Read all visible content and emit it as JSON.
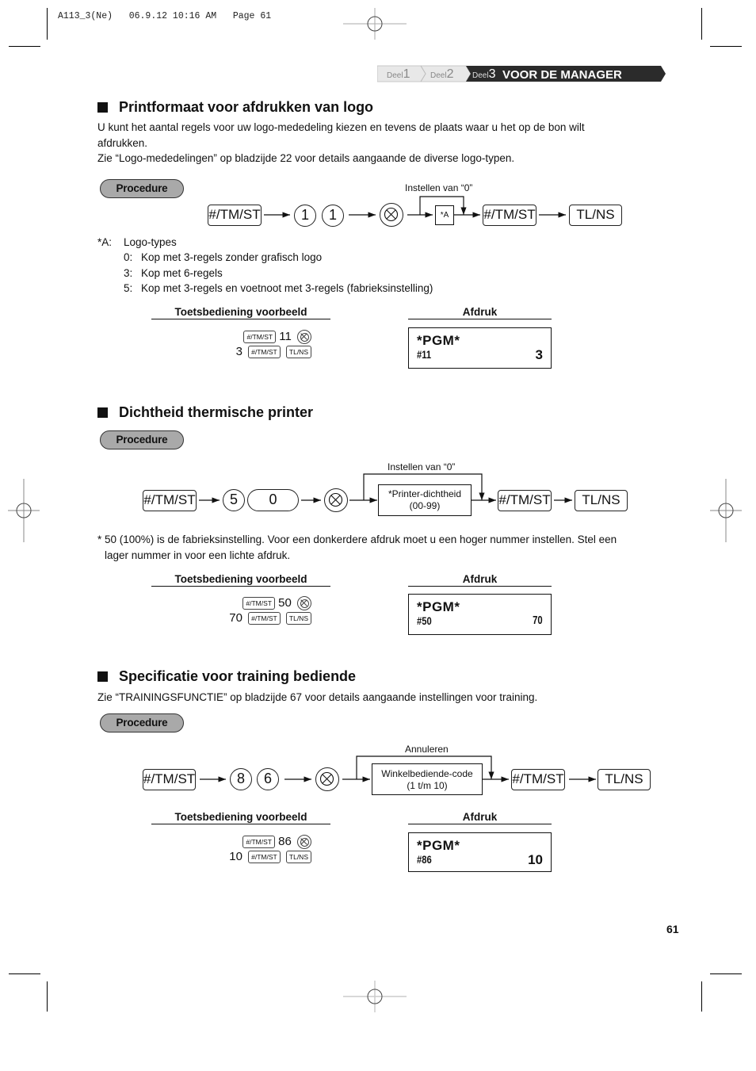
{
  "header_meta": "A113_3(Ne)   06.9.12 10:16 AM   Page 61",
  "breadcrumb": {
    "items": [
      {
        "prefix": "Deel",
        "num": "1"
      },
      {
        "prefix": "Deel",
        "num": "2"
      },
      {
        "prefix": "Deel",
        "num": "3"
      }
    ],
    "current_title": "VOOR DE MANAGER",
    "colors": {
      "active_bg": "#2a2a2a",
      "inactive_bg": "#e6e6e6"
    }
  },
  "sections": [
    {
      "title": "Printformaat voor afdrukken van logo",
      "paragraphs": [
        "U kunt het aantal regels voor uw logo-mededeling kiezen en tevens de plaats waar u het op de bon wilt",
        "afdrukken.",
        "Zie “Logo-mededelingen” op bladzijde 22 voor details aangaande de diverse logo-typen."
      ],
      "procedure_label": "Procedure",
      "flow": {
        "key1": "#/TM/ST",
        "digits": [
          "1",
          "1"
        ],
        "bypass_label": "Instellen van “0”",
        "input_box": "*A",
        "key2": "#/TM/ST",
        "key3": "TL/NS"
      },
      "notes": {
        "label": "*A:",
        "title": "Logo-types",
        "items": [
          {
            "key": "0:",
            "text": "Kop met 3-regels zonder grafisch logo"
          },
          {
            "key": "3:",
            "text": "Kop met 6-regels"
          },
          {
            "key": "5:",
            "text": "Kop met 3-regels en voetnoot met 3-regels (fabrieksinstelling)"
          }
        ]
      },
      "example": {
        "keys_heading": "Toetsbediening voorbeeld",
        "print_heading": "Afdruk",
        "line1": {
          "key": "#/TM/ST",
          "value": "11"
        },
        "line2": {
          "value": "3",
          "key1": "#/TM/ST",
          "key2": "TL/NS"
        },
        "receipt": {
          "title": "*PGM*",
          "code": "#11",
          "value": "3"
        }
      }
    },
    {
      "title": "Dichtheid thermische printer",
      "procedure_label": "Procedure",
      "flow": {
        "key1": "#/TM/ST",
        "digits": [
          "5",
          "0"
        ],
        "bypass_label": "Instellen van “0”",
        "input_box_line1": "*Printer-dichtheid",
        "input_box_line2": "(00-99)",
        "key2": "#/TM/ST",
        "key3": "TL/NS"
      },
      "footnote_line1": "* 50 (100%) is de fabrieksinstelling. Voor een donkerdere afdruk moet u een hoger nummer instellen. Stel een",
      "footnote_line2": "lager nummer in voor een lichte afdruk.",
      "example": {
        "keys_heading": "Toetsbediening voorbeeld",
        "print_heading": "Afdruk",
        "line1": {
          "key": "#/TM/ST",
          "value": "50"
        },
        "line2": {
          "value": "70",
          "key1": "#/TM/ST",
          "key2": "TL/NS"
        },
        "receipt": {
          "title": "*PGM*",
          "code": "#50",
          "value": "70"
        }
      }
    },
    {
      "title": "Specificatie voor training bediende",
      "paragraphs": [
        "Zie “TRAININGSFUNCTIE” op bladzijde 67 voor details aangaande instellingen voor training."
      ],
      "procedure_label": "Procedure",
      "flow": {
        "key1": "#/TM/ST",
        "digits": [
          "8",
          "6"
        ],
        "bypass_label": "Annuleren",
        "input_box_line1": "Winkelbediende-code",
        "input_box_line2": "(1 t/m 10)",
        "key2": "#/TM/ST",
        "key3": "TL/NS"
      },
      "example": {
        "keys_heading": "Toetsbediening voorbeeld",
        "print_heading": "Afdruk",
        "line1": {
          "key": "#/TM/ST",
          "value": "86"
        },
        "line2": {
          "value": "10",
          "key1": "#/TM/ST",
          "key2": "TL/NS"
        },
        "receipt": {
          "title": "*PGM*",
          "code": "#86",
          "value": "10"
        }
      }
    }
  ],
  "page_number": "61"
}
